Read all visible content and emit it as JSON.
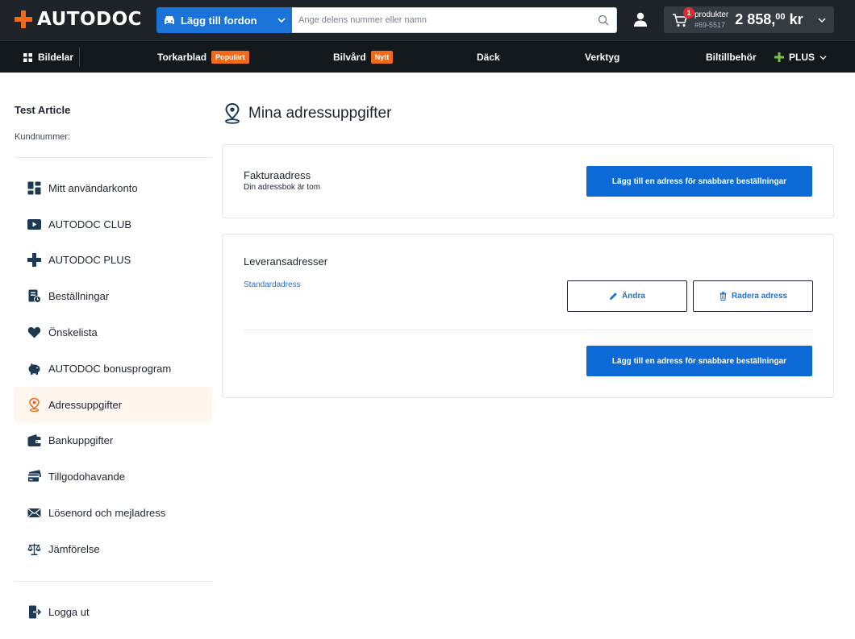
{
  "header": {
    "logo_text": "AUTODOC",
    "vehicle_button_label": "Lägg till fordon",
    "search_placeholder": "Ange delens nummer eller namn",
    "cart": {
      "count": "1",
      "products_label": "produkter",
      "order_ref": "#69-5517",
      "price_main": "2 858,",
      "price_cents": "00",
      "currency": "kr"
    }
  },
  "nav": {
    "bildelar": "Bildelar",
    "torkarblad": "Torkarblad",
    "torkarblad_tag": "Populärt",
    "bilvard": "Bilvård",
    "bilvard_tag": "Nytt",
    "dack": "Däck",
    "verktyg": "Verktyg",
    "biltillbehor": "Biltillbehör",
    "plus": "PLUS"
  },
  "sidebar": {
    "name": "Test Article",
    "customer_number_label": "Kundnummer:",
    "items": [
      {
        "label": "Mitt användarkonto",
        "icon": "dashboard-icon"
      },
      {
        "label": "AUTODOC CLUB",
        "icon": "play-icon"
      },
      {
        "label": "AUTODOC PLUS",
        "icon": "plus-icon"
      },
      {
        "label": "Beställningar",
        "icon": "orders-icon"
      },
      {
        "label": "Önskelista",
        "icon": "heart-icon"
      },
      {
        "label": "AUTODOC bonusprogram",
        "icon": "piggy-bank-icon"
      },
      {
        "label": "Adressuppgifter",
        "icon": "location-pin-icon"
      },
      {
        "label": "Bankuppgifter",
        "icon": "wallet-icon"
      },
      {
        "label": "Tillgodohavande",
        "icon": "credit-card-icon"
      },
      {
        "label": "Lösenord och mejladress",
        "icon": "envelope-icon"
      },
      {
        "label": "Jämförelse",
        "icon": "scales-icon"
      }
    ],
    "logout_label": "Logga ut"
  },
  "main": {
    "title": "Mina adressuppgifter",
    "billing": {
      "title": "Fakturaadress",
      "subtitle": "Din adressbok är tom",
      "add_button": "Lägg till en adress för snabbare beställningar"
    },
    "delivery": {
      "title": "Leveransadresser",
      "default_link": "Standardadress",
      "edit_button": "Ändra",
      "delete_button": "Radera adress",
      "add_button": "Lägg till en adress för snabbare beställningar"
    }
  },
  "colors": {
    "header_bg": "#1e2329",
    "nav_bg": "#13181d",
    "brand_orange": "#f06a1b",
    "primary_blue": "#0b6ad6",
    "active_item_bg": "#fff6ef"
  }
}
